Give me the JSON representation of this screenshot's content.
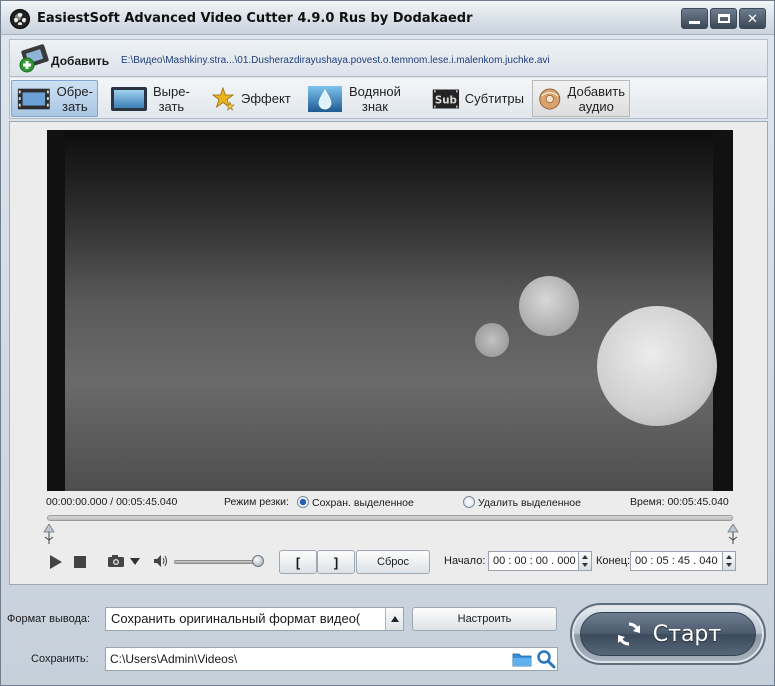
{
  "window": {
    "title": "EasiestSoft Advanced Video Cutter 4.9.0 Rus by Dodakaedr"
  },
  "addrow": {
    "add_label": "Добавить",
    "file_path": "E:\\Видео\\Mashkiny.stra...\\01.Dusherazdirayushaya.povest.o.temnom.lese.i.malenkom.juchke.avi"
  },
  "toolbar": {
    "items": [
      {
        "label_line1": "Обре-",
        "label_line2": "зать",
        "icon": "film-crop-icon"
      },
      {
        "label_line1": "Выре-",
        "label_line2": "зать",
        "icon": "monitor-icon"
      },
      {
        "label_line1": "Эффект",
        "label_line2": "",
        "icon": "stars-icon"
      },
      {
        "label_line1": "Водяной",
        "label_line2": "знак",
        "icon": "water-drop-icon"
      },
      {
        "label_line1": "Субтитры",
        "label_line2": "",
        "icon": "subtitle-icon"
      },
      {
        "label_line1": "Добавить",
        "label_line2": "аудио",
        "icon": "audio-disc-icon"
      }
    ],
    "subtitle_icon_text": "Sub"
  },
  "player": {
    "current_time": "00:00:00.000",
    "total_time": "00:05:45.040",
    "cut_mode_label": "Режим резки:",
    "mode_keep": "Сохран. выделенное",
    "mode_delete": "Удалить выделенное",
    "duration_label": "Время:",
    "duration_value": "00:05:45.040",
    "volume_level": 0.95,
    "mark_in_label": "[",
    "mark_out_label": "]",
    "reset_label": "Сброс",
    "start_label": "Начало:",
    "start_value": "00 : 00 : 00 . 000",
    "end_label": "Конец:",
    "end_value": "00 : 05 : 45 . 040"
  },
  "output": {
    "format_label": "Формат вывода:",
    "format_value": "Сохранить оригинальный формат видео(",
    "settings_label": "Настроить",
    "save_label": "Сохранить:",
    "save_path": "C:\\Users\\Admin\\Videos\\",
    "start_button": "Старт"
  },
  "colors": {
    "accent": "#2a5fb0",
    "start_button": "#4a5a6c"
  }
}
